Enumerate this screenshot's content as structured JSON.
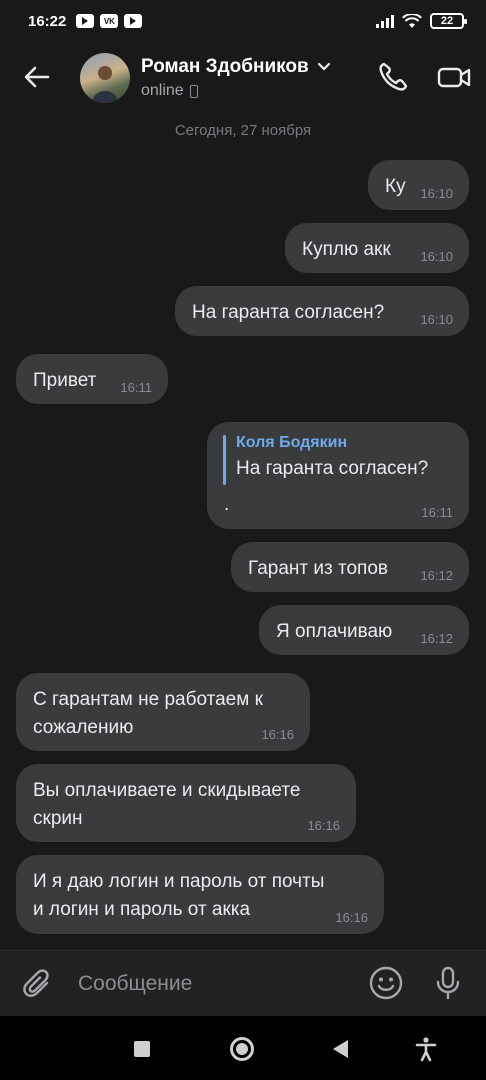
{
  "status_bar": {
    "time": "16:22",
    "app_icons": [
      "youtube-icon",
      "vk-icon",
      "youtube-icon"
    ],
    "battery": "22"
  },
  "header": {
    "contact_name": "Роман Здобников",
    "status": "online"
  },
  "date_separator": "Сегодня, 27 ноября",
  "messages": [
    {
      "direction": "out",
      "text": "Ку",
      "time": "16:10"
    },
    {
      "direction": "out",
      "text": "Куплю акк",
      "time": "16:10"
    },
    {
      "direction": "out",
      "text": "На гаранта согласен?",
      "time": "16:10"
    },
    {
      "direction": "in",
      "text": "Привет",
      "time": "16:11"
    },
    {
      "direction": "out",
      "reply_author": "Коля Бодякин",
      "reply_text": "На гаранта согласен?",
      "text": ".",
      "time": "16:11"
    },
    {
      "direction": "out",
      "text": "Гарант из топов",
      "time": "16:12"
    },
    {
      "direction": "out",
      "text": "Я оплачиваю",
      "time": "16:12"
    },
    {
      "direction": "in",
      "text_lines": [
        "С гарантам не работаем к",
        "сожалению"
      ],
      "time": "16:16"
    },
    {
      "direction": "in",
      "text_lines": [
        "Вы оплачиваете и скидываете",
        "скрин"
      ],
      "time": "16:16"
    },
    {
      "direction": "in",
      "text_lines": [
        "И я даю логин и пароль от почты",
        "и логин и пароль от акка"
      ],
      "time": "16:16"
    }
  ],
  "composer": {
    "placeholder": "Сообщение"
  },
  "colors": {
    "background": "#19191a",
    "bubble": "#3a3b3c",
    "accent": "#71aaeb"
  }
}
